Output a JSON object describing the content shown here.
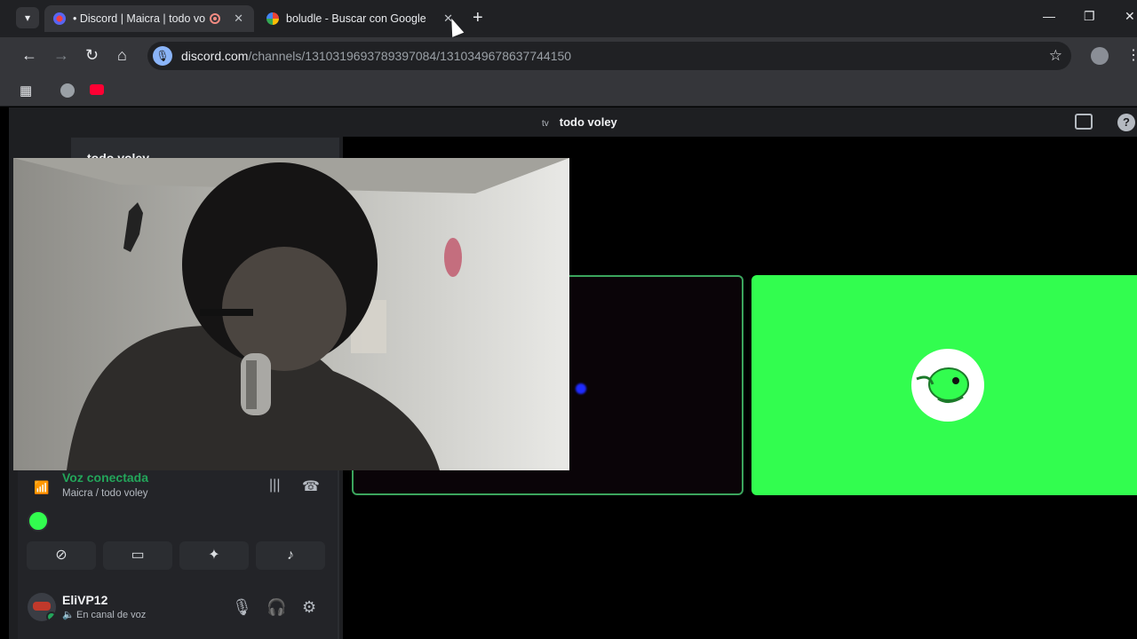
{
  "browser": {
    "tabs": [
      {
        "title": "• Discord | Maicra | todo vo",
        "active": true,
        "recording": true
      },
      {
        "title": "boludle - Buscar con Google",
        "active": false
      }
    ],
    "url_host": "discord.com",
    "url_path": "/channels/1310319693789397084/1310349678637744150",
    "icons": {
      "tab_list": "chevron-down-icon",
      "new_tab": "plus-icon",
      "back": "arrow-left-icon",
      "forward": "arrow-right-icon",
      "reload": "reload-icon",
      "home": "home-icon",
      "bookmark": "star-icon",
      "apps": "grid-icon"
    }
  },
  "discord": {
    "channel_title": "todo voley",
    "channel_prefix": "tv",
    "sidebar_header": "todo voley",
    "voice": {
      "status": "Voz conectada",
      "channel": "Maicra / todo voley"
    },
    "user": {
      "name": "EliVP12",
      "status": "En canal de voz"
    },
    "colors": {
      "connected": "#23a55a",
      "speaking_border": "#3ba55d",
      "tile_green": "#32fd4f",
      "sidebar": "#2b2d31"
    }
  }
}
